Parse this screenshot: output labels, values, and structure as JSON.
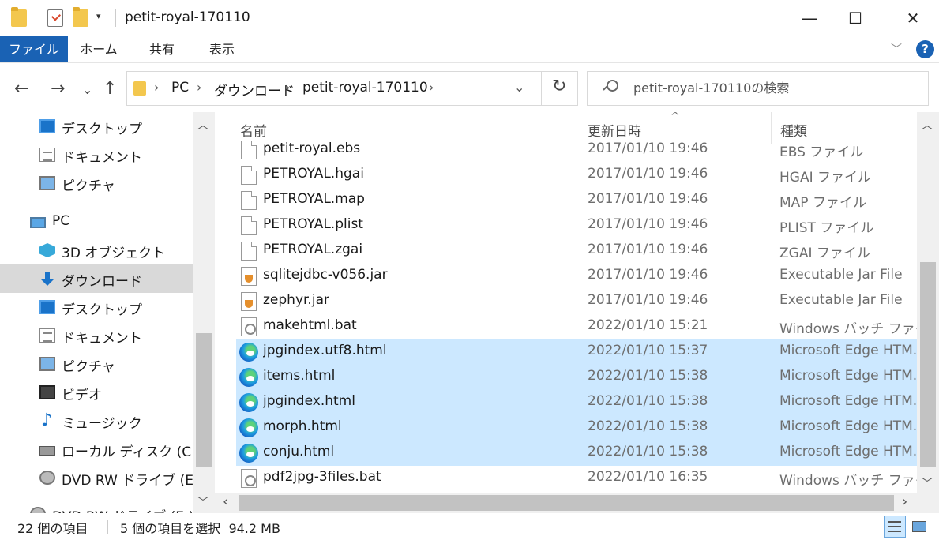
{
  "window": {
    "title": "petit-royal-170110",
    "minimize": "—",
    "maximize": "☐",
    "close": "✕",
    "quick_access_dropdown": "▾"
  },
  "ribbon": {
    "tabs": [
      "ファイル",
      "ホーム",
      "共有",
      "表示"
    ],
    "collapse": "﹀",
    "help": "?"
  },
  "nav": {
    "back": "←",
    "forward": "→",
    "recent": "⌄",
    "up": "↑",
    "breadcrumb": [
      "PC",
      "ダウンロード",
      "petit-royal-170110"
    ],
    "separator": "›",
    "address_dropdown": "⌄",
    "refresh": "↻"
  },
  "search": {
    "placeholder": "petit-royal-170110の検索"
  },
  "sidebar": {
    "items": [
      {
        "label": "デスクトップ",
        "icon": "desktop-icon"
      },
      {
        "label": "ドキュメント",
        "icon": "document-icon"
      },
      {
        "label": "ピクチャ",
        "icon": "pictures-icon"
      },
      {
        "label": "PC",
        "icon": "pc-icon"
      },
      {
        "label": "3D オブジェクト",
        "icon": "3d-objects-icon"
      },
      {
        "label": "ダウンロード",
        "icon": "download-icon"
      },
      {
        "label": "デスクトップ",
        "icon": "desktop-icon"
      },
      {
        "label": "ドキュメント",
        "icon": "document-icon"
      },
      {
        "label": "ピクチャ",
        "icon": "pictures-icon"
      },
      {
        "label": "ビデオ",
        "icon": "video-icon"
      },
      {
        "label": "ミュージック",
        "icon": "music-icon"
      },
      {
        "label": "ローカル ディスク (C:)",
        "icon": "local-disk-icon"
      },
      {
        "label": "DVD RW ドライブ (E:) P",
        "icon": "dvd-drive-icon"
      },
      {
        "label": "DVD RW ドライブ (E:) P",
        "icon": "dvd-drive-icon"
      }
    ],
    "selected_index": 5
  },
  "columns": {
    "name": "名前",
    "date": "更新日時",
    "type": "種類",
    "sort_indicator": "^"
  },
  "files": [
    {
      "name": "petit-royal.ebs",
      "date": "2017/01/10 19:46",
      "type": "EBS ファイル",
      "icon": "generic-file-icon",
      "selected": false
    },
    {
      "name": "PETROYAL.hgai",
      "date": "2017/01/10 19:46",
      "type": "HGAI ファイル",
      "icon": "generic-file-icon",
      "selected": false
    },
    {
      "name": "PETROYAL.map",
      "date": "2017/01/10 19:46",
      "type": "MAP ファイル",
      "icon": "generic-file-icon",
      "selected": false
    },
    {
      "name": "PETROYAL.plist",
      "date": "2017/01/10 19:46",
      "type": "PLIST ファイル",
      "icon": "generic-file-icon",
      "selected": false
    },
    {
      "name": "PETROYAL.zgai",
      "date": "2017/01/10 19:46",
      "type": "ZGAI ファイル",
      "icon": "generic-file-icon",
      "selected": false
    },
    {
      "name": "sqlitejdbc-v056.jar",
      "date": "2017/01/10 19:46",
      "type": "Executable Jar File",
      "icon": "java-jar-icon",
      "selected": false
    },
    {
      "name": "zephyr.jar",
      "date": "2017/01/10 19:46",
      "type": "Executable Jar File",
      "icon": "java-jar-icon",
      "selected": false
    },
    {
      "name": "makehtml.bat",
      "date": "2022/01/10 15:21",
      "type": "Windows バッチ ファイル",
      "icon": "batch-file-icon",
      "selected": false
    },
    {
      "name": "jpgindex.utf8.html",
      "date": "2022/01/10 15:37",
      "type": "Microsoft Edge HTM...",
      "icon": "edge-html-icon",
      "selected": true
    },
    {
      "name": "items.html",
      "date": "2022/01/10 15:38",
      "type": "Microsoft Edge HTM...",
      "icon": "edge-html-icon",
      "selected": true
    },
    {
      "name": "jpgindex.html",
      "date": "2022/01/10 15:38",
      "type": "Microsoft Edge HTM...",
      "icon": "edge-html-icon",
      "selected": true
    },
    {
      "name": "morph.html",
      "date": "2022/01/10 15:38",
      "type": "Microsoft Edge HTM...",
      "icon": "edge-html-icon",
      "selected": true
    },
    {
      "name": "conju.html",
      "date": "2022/01/10 15:38",
      "type": "Microsoft Edge HTM...",
      "icon": "edge-html-icon",
      "selected": true
    },
    {
      "name": "pdf2jpg-3files.bat",
      "date": "2022/01/10 16:35",
      "type": "Windows バッチ ファイル",
      "icon": "batch-file-icon",
      "selected": false
    }
  ],
  "scroll": {
    "up": "︿",
    "down": "﹀",
    "left": "‹",
    "right": "›"
  },
  "status": {
    "item_count": "22 個の項目",
    "selection": "5 個の項目を選択  94.2 MB"
  },
  "colors": {
    "accent": "#1a62b4",
    "selection": "#cce8ff",
    "sidebar_selected": "#d9d9d9"
  }
}
